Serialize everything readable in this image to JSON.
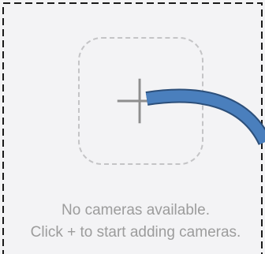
{
  "empty_state": {
    "line1": "No cameras available.",
    "line2": "Click + to start adding cameras."
  },
  "add_button": {
    "icon": "plus-icon"
  },
  "colors": {
    "background": "#f3f3f5",
    "dashed_border": "#c4c4c6",
    "plus": "#8e8e8e",
    "text": "#9c9c9c",
    "annotation_arrow": "#4a7fbd"
  }
}
